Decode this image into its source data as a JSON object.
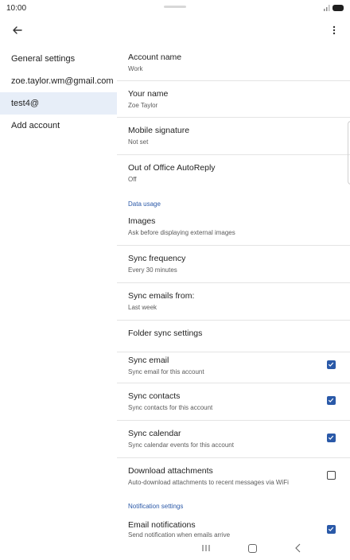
{
  "status_bar": {
    "time": "10:00"
  },
  "sidebar": {
    "items": [
      {
        "label": "General settings"
      },
      {
        "label": "zoe.taylor.wm@gmail.com"
      },
      {
        "label": "test4@"
      },
      {
        "label": "Add account"
      }
    ],
    "selected_index": 2
  },
  "settings": {
    "account_name": {
      "title": "Account name",
      "value": "Work"
    },
    "your_name": {
      "title": "Your name",
      "value": "Zoe Taylor"
    },
    "mobile_signature": {
      "title": "Mobile signature",
      "value": "Not set"
    },
    "out_of_office": {
      "title": "Out of Office AutoReply",
      "value": "Off"
    },
    "data_usage_header": "Data usage",
    "images": {
      "title": "Images",
      "value": "Ask before displaying external images"
    },
    "sync_frequency": {
      "title": "Sync frequency",
      "value": "Every 30 minutes"
    },
    "sync_emails_from": {
      "title": "Sync emails from:",
      "value": "Last week"
    },
    "folder_sync": {
      "title": "Folder sync settings"
    },
    "sync_email": {
      "title": "Sync email",
      "value": "Sync email for this account",
      "checked": true
    },
    "sync_contacts": {
      "title": "Sync contacts",
      "value": "Sync contacts for this account",
      "checked": true
    },
    "sync_calendar": {
      "title": "Sync calendar",
      "value": "Sync calendar events for this account",
      "checked": true
    },
    "download_attachments": {
      "title": "Download attachments",
      "value": "Auto-download attachments to recent messages via WiFi",
      "checked": false
    },
    "notification_header": "Notification settings",
    "email_notifications": {
      "title": "Email notifications",
      "value": "Send notification when emails arrive",
      "checked": true
    }
  },
  "icons": {
    "back": "arrow-left",
    "overflow": "more-vertical",
    "check": "checkmark"
  },
  "colors": {
    "accent": "#2a59a8",
    "selected_bg": "#e7eef8",
    "section_header": "#2b59a8"
  }
}
